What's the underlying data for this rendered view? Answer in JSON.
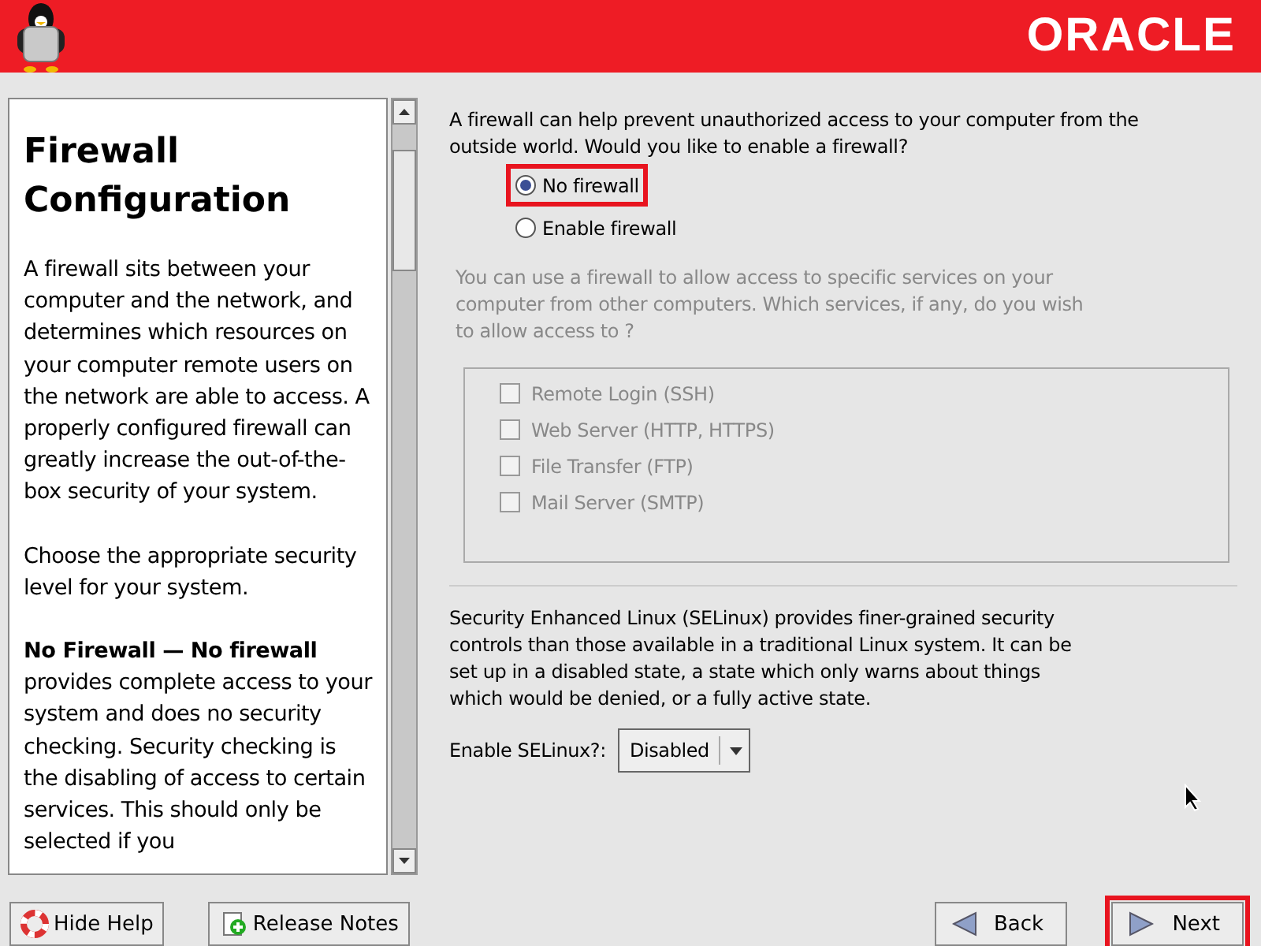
{
  "header": {
    "logo": "ORACLE"
  },
  "help": {
    "title": "Firewall Configuration",
    "paragraphs": [
      "A firewall sits between your computer and the network, and determines which resources on your computer remote users on the network are able to access. A properly configured firewall can greatly increase the out-of-the-box security of your system.",
      "Choose the appropriate security level for your system.",
      "**No Firewall — No firewall** provides complete access to your system and does no security checking. Security checking is the disabling of access to certain services. This should only be selected if you"
    ]
  },
  "firewall": {
    "question": "A firewall can help prevent unauthorized access to your computer from the outside world.  Would you like to enable a firewall?",
    "options": [
      {
        "label": "No firewall",
        "selected": true,
        "highlighted": true
      },
      {
        "label": "Enable firewall",
        "selected": false,
        "highlighted": false
      }
    ],
    "services_intro": "You can use a firewall to allow access to specific services on your computer from other computers. Which services, if any, do you wish to allow access to ?",
    "services": [
      {
        "label": "Remote Login (SSH)",
        "checked": false,
        "disabled": true
      },
      {
        "label": "Web Server (HTTP, HTTPS)",
        "checked": false,
        "disabled": true
      },
      {
        "label": "File Transfer (FTP)",
        "checked": false,
        "disabled": true
      },
      {
        "label": "Mail Server (SMTP)",
        "checked": false,
        "disabled": true
      }
    ]
  },
  "selinux": {
    "description": "Security Enhanced Linux (SELinux) provides finer-grained security controls than those available in a traditional Linux system.  It can be set up in a disabled state, a state which only warns about things which would be denied, or a fully active state.",
    "label": "Enable SELinux?:",
    "value": "Disabled"
  },
  "buttons": [
    {
      "label": "Hide Help",
      "kind": "help",
      "highlighted": false
    },
    {
      "label": "Release Notes",
      "kind": "notes",
      "highlighted": false
    },
    {
      "label": "Back",
      "kind": "back",
      "highlighted": false
    },
    {
      "label": "Next",
      "kind": "next",
      "highlighted": true
    }
  ]
}
